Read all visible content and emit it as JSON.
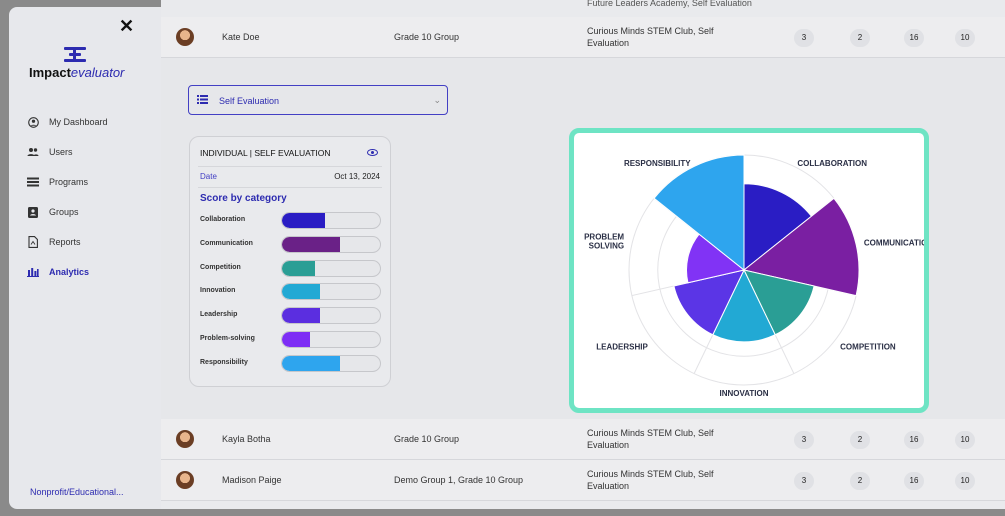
{
  "sidebar": {
    "logo": {
      "brand_bold": "Impact",
      "brand_italic": "evaluator"
    },
    "items": [
      {
        "label": "My Dashboard",
        "icon": "user-circle-icon",
        "active": false
      },
      {
        "label": "Users",
        "icon": "users-icon",
        "active": false
      },
      {
        "label": "Programs",
        "icon": "list-icon",
        "active": false
      },
      {
        "label": "Groups",
        "icon": "group-icon",
        "active": false
      },
      {
        "label": "Reports",
        "icon": "report-icon",
        "active": false
      },
      {
        "label": "Analytics",
        "icon": "analytics-icon",
        "active": true
      }
    ],
    "org": "Nonprofit/Educational..."
  },
  "top_partial_text": "Future Leaders Academy, Self Evaluation",
  "rows": [
    {
      "name": "Kate Doe",
      "group": "Grade 10 Group",
      "programs": "Curious Minds STEM Club, Self Evaluation",
      "n1": "3",
      "n2": "2",
      "n3": "16",
      "n4": "10"
    },
    {
      "name": "Kayla Botha",
      "group": "Grade 10 Group",
      "programs": "Curious Minds STEM Club, Self Evaluation",
      "n1": "3",
      "n2": "2",
      "n3": "16",
      "n4": "10"
    },
    {
      "name": "Madison Paige",
      "group": "Demo Group 1, Grade 10 Group",
      "programs": "Curious Minds STEM Club, Self Evaluation",
      "n1": "3",
      "n2": "2",
      "n3": "16",
      "n4": "10"
    }
  ],
  "evaluation_select": {
    "value": "Self Evaluation"
  },
  "card": {
    "title": "INDIVIDUAL | SELF EVALUATION",
    "date_label": "Date",
    "date_value": "Oct 13, 2024",
    "score_title": "Score by category",
    "categories": [
      {
        "label": "Collaboration",
        "fraction": 0.44,
        "color": "#2a1dc4"
      },
      {
        "label": "Communication",
        "fraction": 0.59,
        "color": "#6a2187"
      },
      {
        "label": "Competition",
        "fraction": 0.34,
        "color": "#2a9e95"
      },
      {
        "label": "Innovation",
        "fraction": 0.39,
        "color": "#22a9d4"
      },
      {
        "label": "Leadership",
        "fraction": 0.39,
        "color": "#5b2ee0"
      },
      {
        "label": "Problem-solving",
        "fraction": 0.29,
        "color": "#7d2ef5"
      },
      {
        "label": "Responsibility",
        "fraction": 0.59,
        "color": "#2ea5ee"
      }
    ]
  },
  "chart_data": {
    "type": "polar-area",
    "categories": [
      "COLLABORATION",
      "COMMUNICATION",
      "COMPETITION",
      "INNOVATION",
      "LEADERSHIP",
      "PROBLEM SOLVING",
      "RESPONSIBILITY"
    ],
    "values": [
      3,
      4,
      2.5,
      2.5,
      2.5,
      2,
      4
    ],
    "max": 4,
    "colors": [
      "#2a1dc4",
      "#7a1fa2",
      "#2a9e95",
      "#22a9d4",
      "#5b35e6",
      "#8133f5",
      "#2ea5ee"
    ],
    "grid": true
  }
}
